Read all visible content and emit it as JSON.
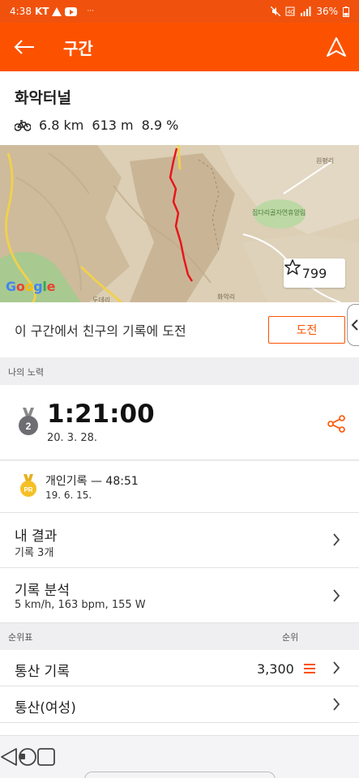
{
  "status_bar": {
    "time": "4:38",
    "carrier": "KT",
    "more": "···",
    "battery": "36%"
  },
  "app_bar": {
    "title": "구간"
  },
  "segment": {
    "name": "화악터널",
    "distance": "6.8 km",
    "elevation": "613 m",
    "grade": "8.9 %"
  },
  "map": {
    "attribution": "Google",
    "star_count": "799",
    "labels": [
      "원평리",
      "집다리골자연휴양림",
      "두데리",
      "화악리"
    ]
  },
  "challenge": {
    "text": "이 구간에서 친구의 기록에 도전",
    "button": "도전"
  },
  "my_efforts": {
    "section_label": "나의 노력",
    "medal_rank": "2",
    "time": "1:21:00",
    "date": "20. 3. 28.",
    "pr_badge": "PR",
    "pr_line": "개인기록 — 48:51",
    "pr_date": "19. 6. 15."
  },
  "results": {
    "title": "내 결과",
    "subtitle": "기록 3개"
  },
  "analysis": {
    "title": "기록 분석",
    "subtitle": "5 km/h, 163 bpm, 155 W"
  },
  "leaderboard": {
    "section_label": "순위표",
    "rank_header": "순위",
    "rows": [
      {
        "label": "통산 기록",
        "rank": "3,300"
      },
      {
        "label": "통산(여성)",
        "rank": ""
      }
    ]
  },
  "colors": {
    "accent": "#fc5200",
    "status": "#f0520d"
  }
}
